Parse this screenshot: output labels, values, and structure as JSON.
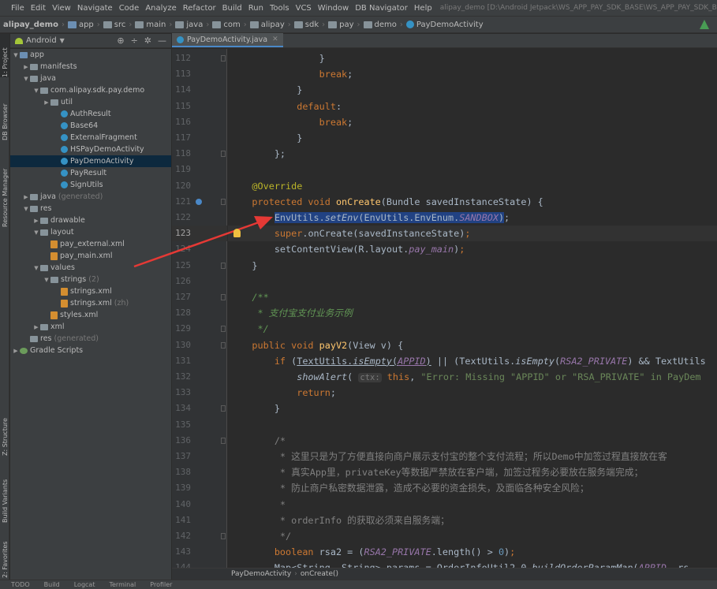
{
  "menu": {
    "items": [
      "File",
      "Edit",
      "View",
      "Navigate",
      "Code",
      "Analyze",
      "Refactor",
      "Build",
      "Run",
      "Tools",
      "VCS",
      "Window",
      "DB Navigator",
      "Help"
    ],
    "window_title": "alipay_demo [D:\\Android Jetpack\\WS_APP_PAY_SDK_BASE\\WS_APP_PAY_SDK_BASE..."
  },
  "breadcrumb": [
    "alipay_demo",
    "app",
    "src",
    "main",
    "java",
    "com",
    "alipay",
    "sdk",
    "pay",
    "demo",
    "PayDemoActivity"
  ],
  "left_tabs": {
    "project": "1: Project",
    "db_browser": "DB Browser",
    "resource_manager": "Resource Manager",
    "structure": "Z: Structure",
    "build_variants": "Build Variants",
    "favorites": "2: Favorites"
  },
  "project_panel": {
    "view_label": "Android"
  },
  "tree": [
    {
      "label": "app",
      "sub": "",
      "indent": 0,
      "arrow": "▼",
      "icon": "mod"
    },
    {
      "label": "manifests",
      "sub": "",
      "indent": 1,
      "arrow": "▶",
      "icon": "folder"
    },
    {
      "label": "java",
      "sub": "",
      "indent": 1,
      "arrow": "▼",
      "icon": "folder"
    },
    {
      "label": "com.alipay.sdk.pay.demo",
      "sub": "",
      "indent": 2,
      "arrow": "▼",
      "icon": "folder"
    },
    {
      "label": "util",
      "sub": "",
      "indent": 3,
      "arrow": "▶",
      "icon": "folder"
    },
    {
      "label": "AuthResult",
      "sub": "",
      "indent": 4,
      "arrow": "",
      "icon": "cls"
    },
    {
      "label": "Base64",
      "sub": "",
      "indent": 4,
      "arrow": "",
      "icon": "cls"
    },
    {
      "label": "ExternalFragment",
      "sub": "",
      "indent": 4,
      "arrow": "",
      "icon": "cls"
    },
    {
      "label": "HSPayDemoActivity",
      "sub": "",
      "indent": 4,
      "arrow": "",
      "icon": "cls"
    },
    {
      "label": "PayDemoActivity",
      "sub": "",
      "indent": 4,
      "arrow": "",
      "icon": "cls",
      "selected": true
    },
    {
      "label": "PayResult",
      "sub": "",
      "indent": 4,
      "arrow": "",
      "icon": "cls"
    },
    {
      "label": "SignUtils",
      "sub": "",
      "indent": 4,
      "arrow": "",
      "icon": "cls"
    },
    {
      "label": "java",
      "sub": "(generated)",
      "indent": 1,
      "arrow": "▶",
      "icon": "folder"
    },
    {
      "label": "res",
      "sub": "",
      "indent": 1,
      "arrow": "▼",
      "icon": "folder"
    },
    {
      "label": "drawable",
      "sub": "",
      "indent": 2,
      "arrow": "▶",
      "icon": "folder"
    },
    {
      "label": "layout",
      "sub": "",
      "indent": 2,
      "arrow": "▼",
      "icon": "folder"
    },
    {
      "label": "pay_external.xml",
      "sub": "",
      "indent": 3,
      "arrow": "",
      "icon": "xml"
    },
    {
      "label": "pay_main.xml",
      "sub": "",
      "indent": 3,
      "arrow": "",
      "icon": "xml"
    },
    {
      "label": "values",
      "sub": "",
      "indent": 2,
      "arrow": "▼",
      "icon": "folder"
    },
    {
      "label": "strings",
      "sub": "(2)",
      "indent": 3,
      "arrow": "▼",
      "icon": "folder"
    },
    {
      "label": "strings.xml",
      "sub": "",
      "indent": 4,
      "arrow": "",
      "icon": "xml"
    },
    {
      "label": "strings.xml",
      "sub": "(zh)",
      "indent": 4,
      "arrow": "",
      "icon": "xml"
    },
    {
      "label": "styles.xml",
      "sub": "",
      "indent": 3,
      "arrow": "",
      "icon": "xml"
    },
    {
      "label": "xml",
      "sub": "",
      "indent": 2,
      "arrow": "▶",
      "icon": "folder"
    },
    {
      "label": "res",
      "sub": "(generated)",
      "indent": 1,
      "arrow": "",
      "icon": "folder"
    },
    {
      "label": "Gradle Scripts",
      "sub": "",
      "indent": 0,
      "arrow": "▶",
      "icon": "gradle"
    }
  ],
  "editor": {
    "tab_label": "PayDemoActivity.java",
    "first_line": 112,
    "current_line": 123,
    "lines": [
      [
        [
          "",
          "                }"
        ]
      ],
      [
        [
          "kw",
          "                break"
        ],
        [
          "",
          ";"
        ]
      ],
      [
        [
          "",
          "            }"
        ]
      ],
      [
        [
          "kw",
          "            default"
        ],
        [
          "",
          ":"
        ]
      ],
      [
        [
          "kw",
          "                break"
        ],
        [
          "",
          ";"
        ]
      ],
      [
        [
          "",
          "            }"
        ]
      ],
      [
        [
          "",
          "        };"
        ]
      ],
      [
        [
          "",
          ""
        ]
      ],
      [
        [
          "ann",
          "    @Override"
        ]
      ],
      [
        [
          "kw",
          "    protected void "
        ],
        [
          "fn",
          "onCreate"
        ],
        [
          "",
          "(Bundle savedInstanceState) {"
        ]
      ],
      [
        [
          "",
          "        "
        ],
        [
          "sel",
          "EnvUtils."
        ],
        [
          "sel st",
          "setEnv"
        ],
        [
          "sel",
          "(EnvUtils.EnvEnum."
        ],
        [
          "sel cst",
          "SANDBOX"
        ],
        [
          "sel",
          ")"
        ],
        [
          "",
          ";"
        ]
      ],
      [
        [
          "kw",
          "        super"
        ],
        [
          "",
          ".onCreate(savedInstanceState)"
        ],
        [
          "kw",
          ";"
        ]
      ],
      [
        [
          "",
          "        setContentView(R.layout."
        ],
        [
          "cst",
          "pay_main"
        ],
        [
          "",
          ")"
        ],
        [
          "kw",
          ";"
        ]
      ],
      [
        [
          "",
          "    }"
        ]
      ],
      [
        [
          "",
          ""
        ]
      ],
      [
        [
          "cmt",
          "    /**"
        ]
      ],
      [
        [
          "cmt",
          "     * 支付宝支付业务示例"
        ]
      ],
      [
        [
          "cmt",
          "     */"
        ]
      ],
      [
        [
          "kw",
          "    public void "
        ],
        [
          "fn",
          "payV2"
        ],
        [
          "",
          "(View v) {"
        ]
      ],
      [
        [
          "kw",
          "        if "
        ],
        [
          "",
          "("
        ],
        [
          "ul",
          "TextUtils."
        ],
        [
          "ul st",
          "isEmpty"
        ],
        [
          "ul",
          "("
        ],
        [
          "ul cst",
          "APPID"
        ],
        [
          "ul",
          ")"
        ],
        [
          "",
          " || (TextUtils."
        ],
        [
          "st",
          "isEmpty"
        ],
        [
          "",
          "("
        ],
        [
          "cst",
          "RSA2_PRIVATE"
        ],
        [
          "",
          ") && TextUtils"
        ]
      ],
      [
        [
          "st",
          "            showAlert"
        ],
        [
          "",
          "( "
        ],
        [
          "hint",
          "ctx:"
        ],
        [
          "kw",
          " this"
        ],
        [
          "",
          ", "
        ],
        [
          "str",
          "\"Error: Missing \"APPID\" or \"RSA_PRIVATE\" in PayDem"
        ]
      ],
      [
        [
          "kw",
          "            return"
        ],
        [
          "",
          ";"
        ]
      ],
      [
        [
          "",
          "        }"
        ]
      ],
      [
        [
          "",
          ""
        ]
      ],
      [
        [
          "cmtgray",
          "        /*"
        ]
      ],
      [
        [
          "cmtgray",
          "         * 这里只是为了方便直接向商户展示支付宝的整个支付流程；所以Demo中加签过程直接放在客"
        ]
      ],
      [
        [
          "cmtgray",
          "         * 真实App里，privateKey等数据严禁放在客户端，加签过程务必要放在服务端完成；"
        ]
      ],
      [
        [
          "cmtgray",
          "         * 防止商户私密数据泄露，造成不必要的资金损失，及面临各种安全风险；"
        ]
      ],
      [
        [
          "cmtgray",
          "         *"
        ]
      ],
      [
        [
          "cmtgray",
          "         * orderInfo 的获取必须来自服务端；"
        ]
      ],
      [
        [
          "cmtgray",
          "         */"
        ]
      ],
      [
        [
          "kw",
          "        boolean "
        ],
        [
          "",
          "rsa2 = ("
        ],
        [
          "cst",
          "RSA2_PRIVATE"
        ],
        [
          "",
          ".length() > "
        ],
        [
          "num",
          "0"
        ],
        [
          "",
          ")"
        ],
        [
          "kw",
          ";"
        ]
      ],
      [
        [
          "",
          "        Map<String, String> params = OrderInfoUtil2_0."
        ],
        [
          "st",
          "buildOrderParamMap"
        ],
        [
          "",
          "("
        ],
        [
          "cst",
          "APPID"
        ],
        [
          "",
          ", rs"
        ]
      ]
    ]
  },
  "bottom_breadcrumb": [
    "PayDemoActivity",
    "onCreate()"
  ],
  "status": [
    "TODO",
    "Build",
    "Logcat",
    "Terminal",
    "Profiler"
  ]
}
